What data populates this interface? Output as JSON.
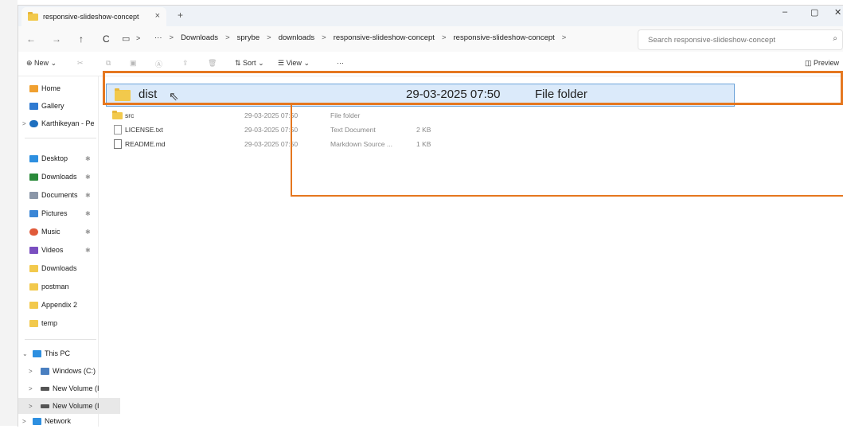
{
  "window": {
    "tab_title": "responsive-slideshow-concept",
    "tab_close": "×",
    "new_tab": "+",
    "minimize": "–",
    "maximize": "▢",
    "close": "✕"
  },
  "address": {
    "back": "←",
    "forward": "→",
    "up": "↑",
    "refresh": "C",
    "more": "···",
    "crumbs": [
      "Downloads",
      "sprybe",
      "downloads",
      "responsive-slideshow-concept",
      "responsive-slideshow-concept"
    ],
    "separator": ">",
    "search_placeholder": "Search responsive-slideshow-concept"
  },
  "command_bar": {
    "new_label": "New",
    "sort_label": "Sort",
    "view_label": "View",
    "more_label": "···",
    "preview_label": "Preview"
  },
  "sidebar": {
    "top": [
      {
        "label": "Home",
        "icon": "home-icon",
        "color": "#f0a030"
      },
      {
        "label": "Gallery",
        "icon": "gallery-icon",
        "color": "#2f7ad1"
      },
      {
        "label": "Karthikeyan - Pe",
        "icon": "cloud-icon",
        "color": "#1e6fbf"
      }
    ],
    "pinned": [
      {
        "label": "Desktop",
        "icon": "desktop-icon",
        "color": "#2d8fe0"
      },
      {
        "label": "Downloads",
        "icon": "downloads-icon",
        "color": "#2a8a3a"
      },
      {
        "label": "Documents",
        "icon": "documents-icon",
        "color": "#8a96a8"
      },
      {
        "label": "Pictures",
        "icon": "pictures-icon",
        "color": "#3a86d6"
      },
      {
        "label": "Music",
        "icon": "music-icon",
        "color": "#e05a3a"
      },
      {
        "label": "Videos",
        "icon": "videos-icon",
        "color": "#7a4fc0"
      }
    ],
    "folders": [
      {
        "label": "Downloads",
        "icon": "folder-icon",
        "color": "#f2c94c"
      },
      {
        "label": "postman",
        "icon": "folder-icon",
        "color": "#f2c94c"
      },
      {
        "label": "Appendix 2",
        "icon": "folder-icon",
        "color": "#f2c94c"
      },
      {
        "label": "temp",
        "icon": "folder-icon",
        "color": "#f2c94c"
      }
    ],
    "pc": [
      {
        "label": "This PC",
        "icon": "pc-icon",
        "color": "#2d8fe0"
      },
      {
        "label": "Windows (C:)",
        "icon": "drive-icon",
        "color": "#4a7fc0"
      },
      {
        "label": "New Volume (I",
        "icon": "drive-icon",
        "color": "#555"
      },
      {
        "label": "New Volume (I",
        "icon": "drive-icon",
        "color": "#555"
      },
      {
        "label": "Network",
        "icon": "network-icon",
        "color": "#2d8fe0"
      }
    ]
  },
  "files": {
    "zoomed": {
      "name": "dist",
      "date": "29-03-2025 07:50",
      "type": "File folder"
    },
    "rows": [
      {
        "name": "src",
        "date": "29-03-2025 07:50",
        "type": "File folder",
        "size": ""
      },
      {
        "name": "LICENSE.txt",
        "date": "29-03-2025 07:50",
        "type": "Text Document",
        "size": "2 KB"
      },
      {
        "name": "README.md",
        "date": "29-03-2025 07:50",
        "type": "Markdown Source ...",
        "size": "1 KB"
      }
    ]
  },
  "colors": {
    "highlight": "#e5771f",
    "selection": "#dbeafa"
  }
}
